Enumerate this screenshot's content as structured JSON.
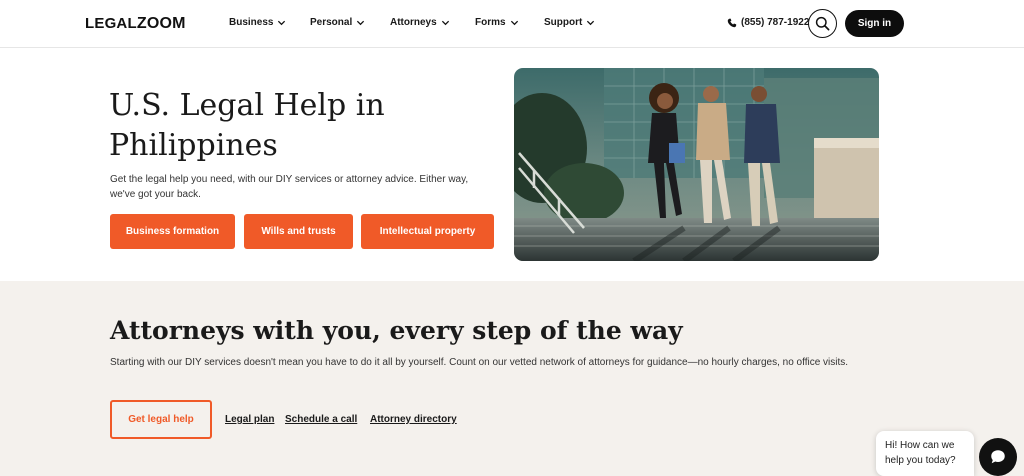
{
  "header": {
    "logo": {
      "part1": "LEGAL",
      "part2": "ZOOM"
    },
    "nav": [
      {
        "label": "Business"
      },
      {
        "label": "Personal"
      },
      {
        "label": "Attorneys"
      },
      {
        "label": "Forms"
      },
      {
        "label": "Support"
      }
    ],
    "phone": "(855) 787-1922",
    "sign_in": "Sign in",
    "icons": {
      "phone": "phone-icon",
      "search": "search-icon",
      "chevron": "chevron-down-icon"
    }
  },
  "hero": {
    "title_line1": "U.S. Legal Help in",
    "title_line2": "Philippines",
    "subtitle": "Get the legal help you need, with our DIY services or attorney advice. Either way, we've got your back.",
    "buttons": [
      {
        "label": "Business formation"
      },
      {
        "label": "Wills and trusts"
      },
      {
        "label": "Intellectual property"
      }
    ]
  },
  "attorneys": {
    "title": "Attorneys with you, every step of the way",
    "subtitle": "Starting with our DIY services doesn't mean you have to do it all by yourself. Count on our vetted network of attorneys for guidance—no hourly charges, no office visits.",
    "primary_button": "Get legal help",
    "links": [
      {
        "label": "Legal plan"
      },
      {
        "label": "Schedule a call"
      },
      {
        "label": "Attorney directory"
      }
    ]
  },
  "chat": {
    "line1": "Hi! How can we",
    "line2": "help you today?"
  },
  "colors": {
    "accent": "#f05a28",
    "band": "#f4f1ed",
    "dark": "#0d0d0d"
  }
}
